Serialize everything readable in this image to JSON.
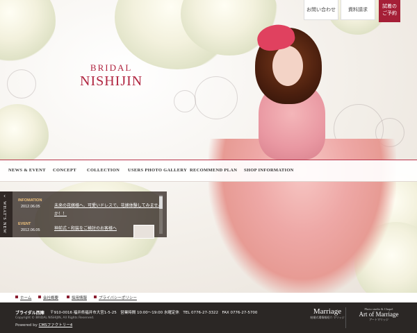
{
  "brand": {
    "small": "BRIDAL",
    "big": "NISHIJIN",
    "color": "#b0243f"
  },
  "topbar": {
    "contact_label": "お問い合わせ",
    "brochure_label": "資料請求",
    "reserve_line1": "試着の",
    "reserve_line2": "ご予約"
  },
  "nav": {
    "items": [
      "NEWS & EVENT",
      "CONCEPT",
      "COLLECTION",
      "USERS PHOTO GALLERY",
      "RECOMMEND PLAN",
      "SHOP INFORMATION"
    ]
  },
  "news": {
    "tab_label": "WHAT'S NEW",
    "entries": [
      {
        "category": "INFOMATION",
        "date": "2012.06.05",
        "title_line1": "未来の花嫁様へ、可愛いドレスで、花嫁体験してみません",
        "title_line2": "か！！"
      },
      {
        "category": "EVENT",
        "date": "2012.06.05",
        "title_line1": "神前式・和装をご検討のお客様へ"
      }
    ]
  },
  "footer_links": [
    "ホーム",
    "会社概要",
    "採用情報",
    "プライバシーポリシー"
  ],
  "footer": {
    "name": "ブライダル西陣",
    "address": "〒910-0016 福井県福井市大宮1-5-25　営業時間 10:00～19:00 水曜定休　TEL 0776-27-3322　FAX 0776-27-5700",
    "copyright": "Copyright © BRIDAL NISHIJIN, All Rights Reserved.",
    "powered_prefix": "Powered by ",
    "powered_link": "CMSファクトリー4",
    "logo1_main": "Marriage",
    "logo1_sub": "結婚式場情報紹介 マリッジ",
    "logo2_top": "Photo studio & Chapel",
    "logo2_main": "Art of Marriage",
    "logo2_sub": "アートマリッジ"
  }
}
